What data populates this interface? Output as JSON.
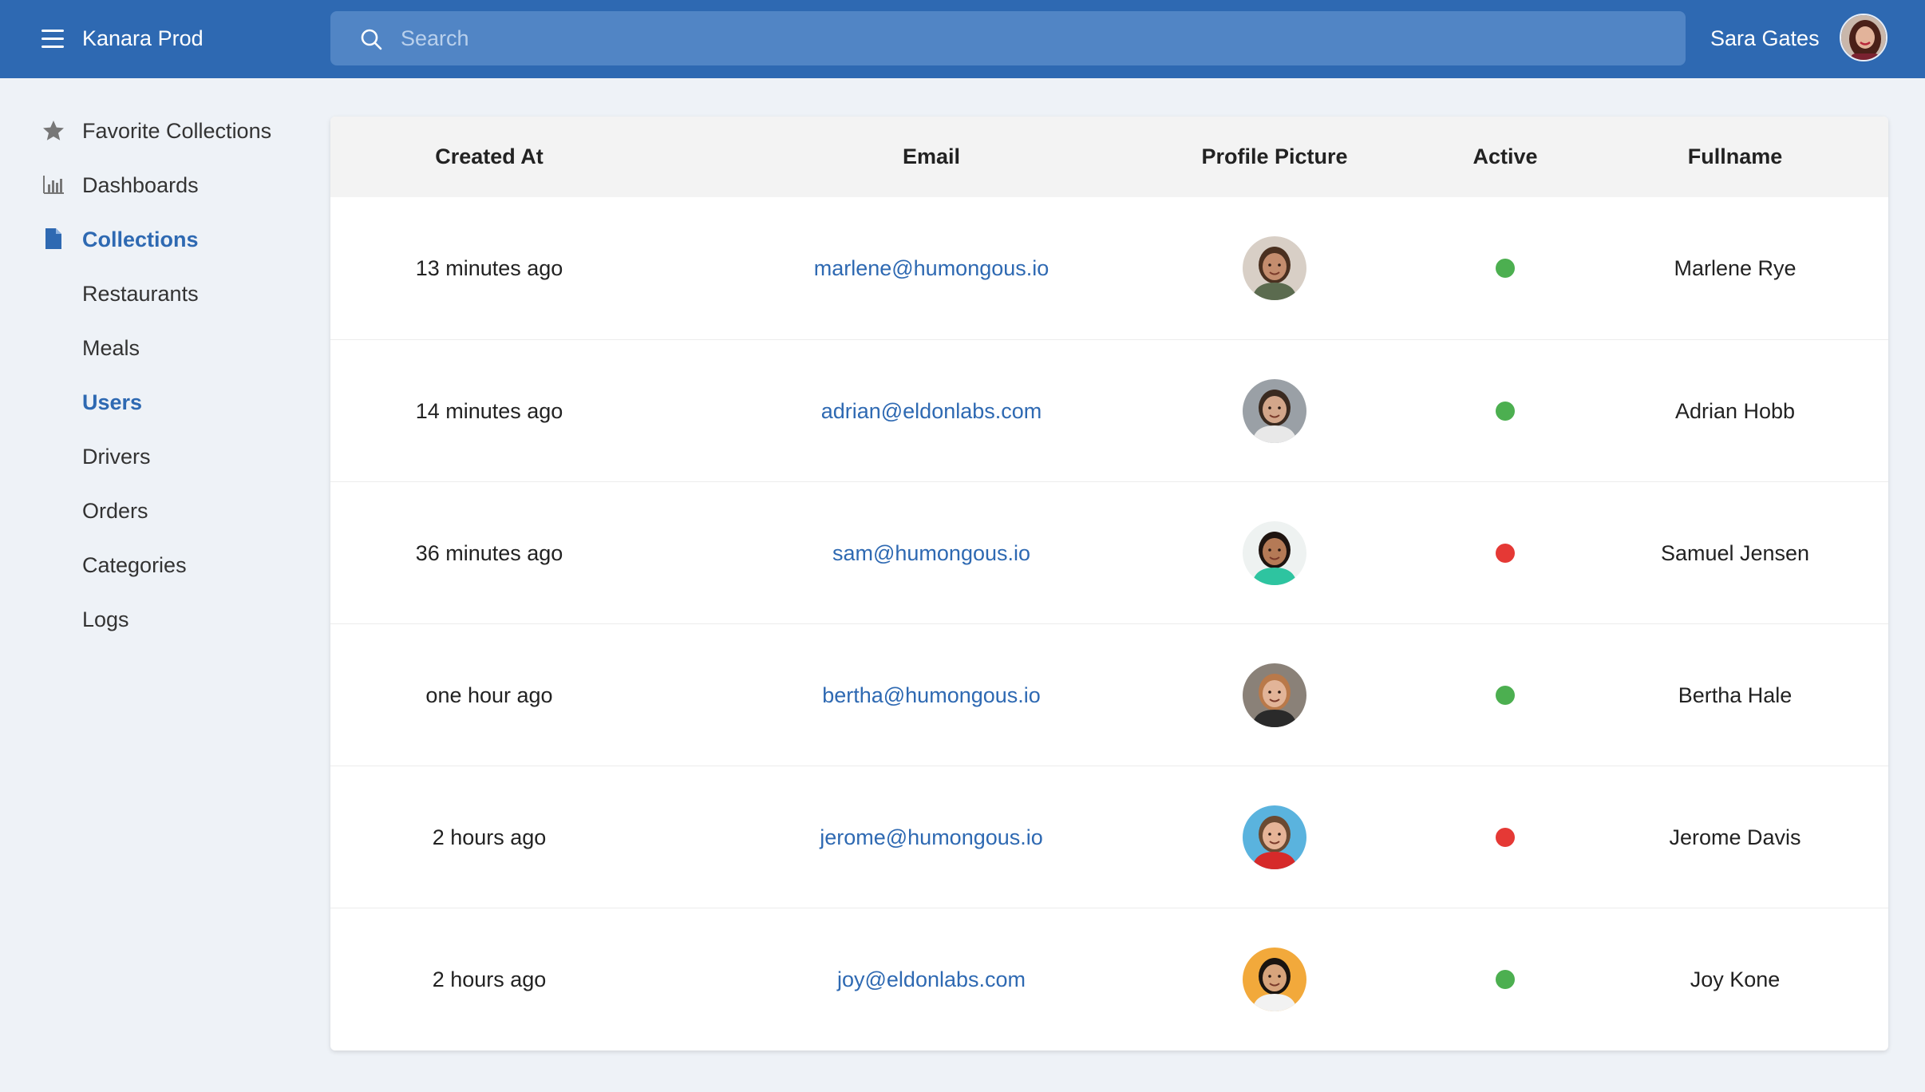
{
  "app": {
    "title": "Kanara Prod",
    "user_name": "Sara Gates"
  },
  "search": {
    "placeholder": "Search"
  },
  "colors": {
    "header_bg": "#2e69b2",
    "search_bg": "#5185c5",
    "active_link": "#2e69b2",
    "status_active": "#4caf50",
    "status_inactive": "#e53935"
  },
  "sidebar": {
    "items": [
      {
        "label": "Favorite Collections",
        "icon": "star-icon"
      },
      {
        "label": "Dashboards",
        "icon": "bar-chart-icon"
      },
      {
        "label": "Collections",
        "icon": "document-icon",
        "active": true
      },
      {
        "label": "Restaurants"
      },
      {
        "label": "Meals"
      },
      {
        "label": "Users",
        "active": true
      },
      {
        "label": "Drivers"
      },
      {
        "label": "Orders"
      },
      {
        "label": "Categories"
      },
      {
        "label": "Logs"
      }
    ]
  },
  "table": {
    "columns": [
      "Created At",
      "Email",
      "Profile Picture",
      "Active",
      "Fullname"
    ],
    "rows": [
      {
        "created_at": "13 minutes ago",
        "email": "marlene@humongous.io",
        "active": true,
        "fullname": "Marlene Rye",
        "avatar": {
          "bg": "#d8cfc6",
          "skin": "#c48d6e",
          "hair": "#4a3020",
          "shirt": "#5b6b4f"
        }
      },
      {
        "created_at": "14 minutes ago",
        "email": "adrian@eldonlabs.com",
        "active": true,
        "fullname": "Adrian Hobb",
        "avatar": {
          "bg": "#9aa0a6",
          "skin": "#d3a68a",
          "hair": "#3a2a20",
          "shirt": "#e8e8e8"
        }
      },
      {
        "created_at": "36 minutes ago",
        "email": "sam@humongous.io",
        "active": false,
        "fullname": "Samuel Jensen",
        "avatar": {
          "bg": "#eef2f1",
          "skin": "#b57a56",
          "hair": "#1e1410",
          "shirt": "#2ec4a0"
        }
      },
      {
        "created_at": "one hour ago",
        "email": "bertha@humongous.io",
        "active": true,
        "fullname": "Bertha Hale",
        "avatar": {
          "bg": "#8a8178",
          "skin": "#e2b498",
          "hair": "#b9794a",
          "shirt": "#2a2a2a"
        }
      },
      {
        "created_at": "2 hours ago",
        "email": "jerome@humongous.io",
        "active": false,
        "fullname": "Jerome Davis",
        "avatar": {
          "bg": "#5ab3de",
          "skin": "#e6b497",
          "hair": "#6b4a32",
          "shirt": "#d62a2a"
        }
      },
      {
        "created_at": "2 hours ago",
        "email": "joy@eldonlabs.com",
        "active": true,
        "fullname": "Joy Kone",
        "avatar": {
          "bg": "#f2a93b",
          "skin": "#d7a47c",
          "hair": "#1a1410",
          "shirt": "#f2f2f2"
        }
      }
    ]
  }
}
